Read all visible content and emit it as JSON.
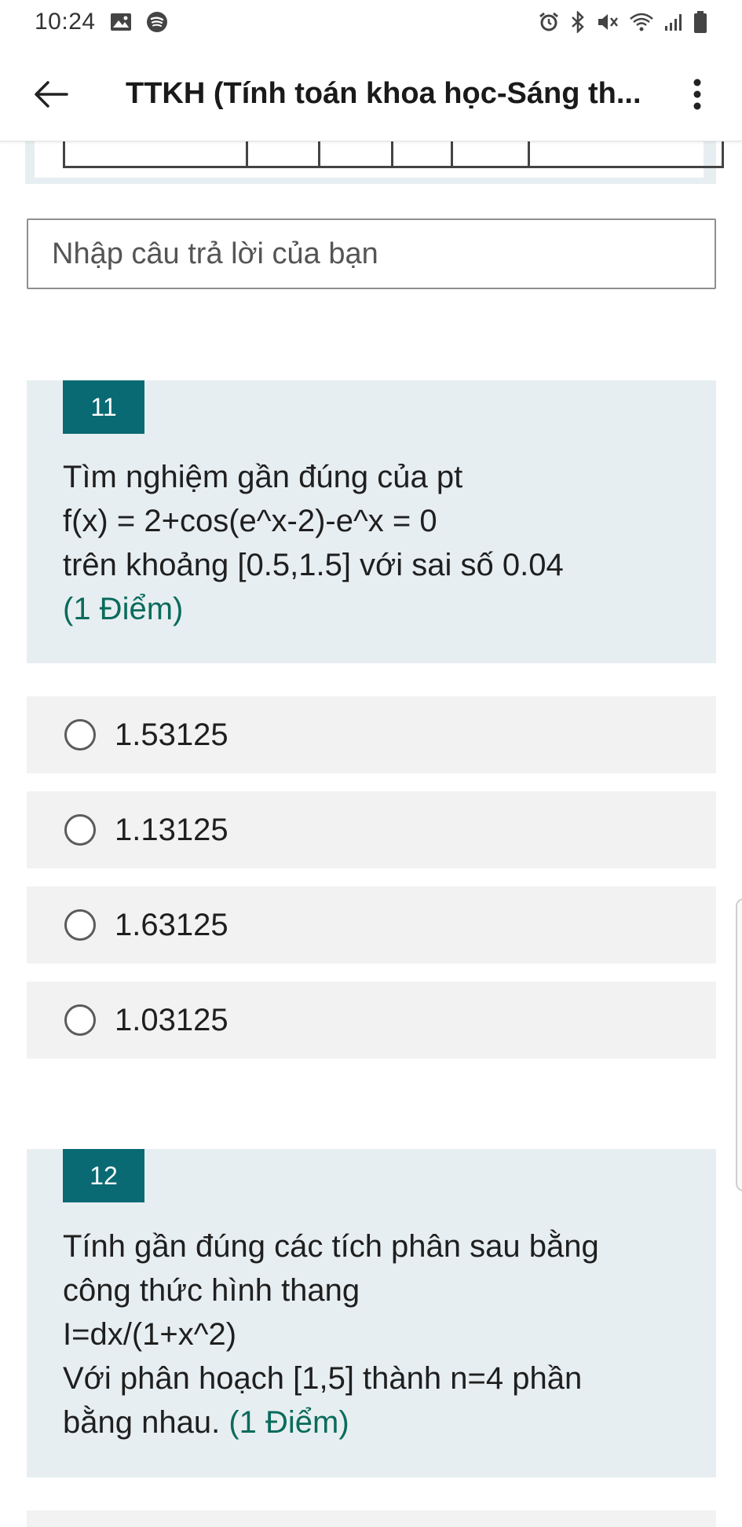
{
  "status_bar": {
    "time": "10:24"
  },
  "app_bar": {
    "title": "TTKH (Tính toán khoa học-Sáng th..."
  },
  "answer_input": {
    "placeholder": "Nhập câu trả lời của bạn"
  },
  "questions": [
    {
      "number": "11",
      "lines": [
        "Tìm nghiệm gần đúng của pt",
        "f(x) = 2+cos(e^x-2)-e^x = 0",
        "trên khoảng [0.5,1.5] với sai số 0.04"
      ],
      "points": "(1 Điểm)",
      "options": [
        "1.53125",
        "1.13125",
        "1.63125",
        "1.03125"
      ]
    },
    {
      "number": "12",
      "lines": [
        "Tính gần đúng các tích phân sau bằng",
        "công thức hình thang",
        "I=dx/(1+x^2)",
        "Với phân hoạch [1,5] thành n=4 phần",
        "bằng nhau."
      ],
      "points": "(1 Điểm)"
    }
  ],
  "colors": {
    "accent": "#096a73",
    "points": "#0b6b5c",
    "card_bg": "#e7eef1",
    "option_bg": "#f2f2f2"
  }
}
